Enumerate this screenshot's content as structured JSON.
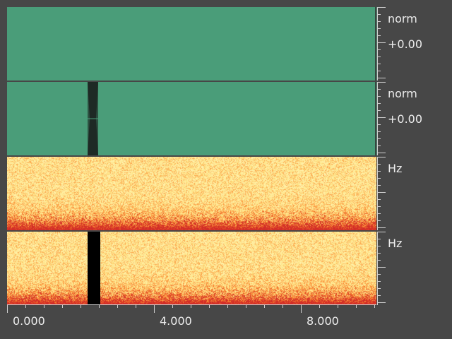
{
  "tracks": [
    {
      "type": "waveform",
      "unit_label": "norm",
      "value_label": "+0.00",
      "has_gap": false
    },
    {
      "type": "waveform",
      "unit_label": "norm",
      "value_label": "+0.00",
      "has_gap": true
    },
    {
      "type": "spectrogram",
      "unit_label": "Hz",
      "has_gap": false
    },
    {
      "type": "spectrogram",
      "unit_label": "Hz",
      "has_gap": true
    }
  ],
  "time_ruler": {
    "labels": [
      "0.000",
      "4.000",
      "8.000"
    ]
  },
  "colors": {
    "background": "#474747",
    "waveform": "#4a9d79",
    "gap_waveform": "#1e2a25",
    "gap_spectrogram": "#000000",
    "spectrogram_base": "#fff1b0",
    "spectrogram_hot": "#e33a1c"
  }
}
